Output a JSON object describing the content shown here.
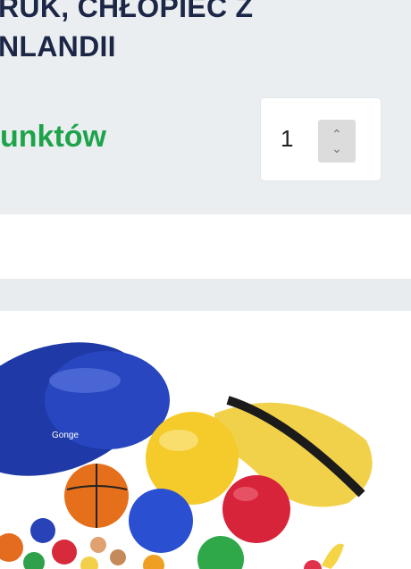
{
  "product": {
    "title_lines": [
      "RUK, CHŁOPIEC Z",
      "NLANDII"
    ],
    "points_label": "unktów"
  },
  "quantity": {
    "value": "1"
  },
  "image": {
    "alt_brand_text": "Gonge"
  },
  "colors": {
    "title": "#1c2747",
    "points": "#1fa34a",
    "card_bg": "#eaeef1"
  }
}
